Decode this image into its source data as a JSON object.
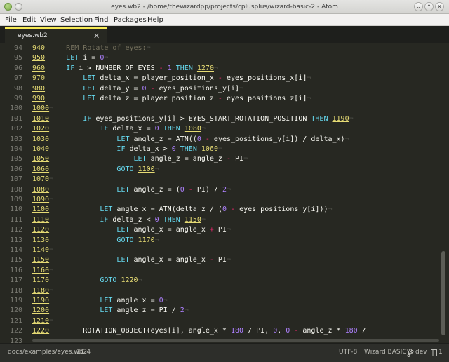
{
  "window": {
    "title": "eyes.wb2 - /home/thewizardpp/projects/cplusplus/wizard-basic-2 - Atom",
    "controls": {
      "minimize": "⌄",
      "maximize": "⌃",
      "close": "✕"
    }
  },
  "menu": [
    "File",
    "Edit",
    "View",
    "Selection",
    "Find",
    "Packages",
    "Help"
  ],
  "tab": {
    "label": "eyes.wb2",
    "close": "✕"
  },
  "colors": {
    "editor_bg": "#272822",
    "label": "#e6db74",
    "keyword": "#66d9ef",
    "operator": "#f92672",
    "number": "#ae81ff",
    "comment": "#75715e",
    "tab_accent": "#f7ea56"
  },
  "lines": [
    {
      "n": "94",
      "t": [
        [
          "lbl",
          "940"
        ],
        [
          "pl",
          "     "
        ],
        [
          "cmt",
          "REM Rotate of eyes:"
        ],
        [
          "ivs",
          "¬"
        ]
      ]
    },
    {
      "n": "95",
      "t": [
        [
          "lbl",
          "950"
        ],
        [
          "pl",
          "     "
        ],
        [
          "kw",
          "LET"
        ],
        [
          "pl",
          " i = "
        ],
        [
          "num",
          "0"
        ],
        [
          "ivs",
          "¬"
        ]
      ]
    },
    {
      "n": "96",
      "t": [
        [
          "lbl",
          "960"
        ],
        [
          "pl",
          "     "
        ],
        [
          "kw",
          "IF"
        ],
        [
          "pl",
          " i > NUMBER_OF_EYES "
        ],
        [
          "op",
          "-"
        ],
        [
          "pl",
          " "
        ],
        [
          "num",
          "1"
        ],
        [
          "pl",
          " "
        ],
        [
          "kw",
          "THEN"
        ],
        [
          "pl",
          " "
        ],
        [
          "lbl",
          "1270"
        ],
        [
          "ivs",
          "¬"
        ]
      ]
    },
    {
      "n": "97",
      "t": [
        [
          "lbl",
          "970"
        ],
        [
          "pl",
          "         "
        ],
        [
          "kw",
          "LET"
        ],
        [
          "pl",
          " delta_x = player_position_x "
        ],
        [
          "op",
          "-"
        ],
        [
          "pl",
          " eyes_positions_x[i]"
        ],
        [
          "ivs",
          "¬"
        ]
      ]
    },
    {
      "n": "98",
      "t": [
        [
          "lbl",
          "980"
        ],
        [
          "pl",
          "         "
        ],
        [
          "kw",
          "LET"
        ],
        [
          "pl",
          " delta_y = "
        ],
        [
          "num",
          "0"
        ],
        [
          "pl",
          " "
        ],
        [
          "op",
          "-"
        ],
        [
          "pl",
          " eyes_positions_y[i]"
        ],
        [
          "ivs",
          "¬"
        ]
      ]
    },
    {
      "n": "99",
      "t": [
        [
          "lbl",
          "990"
        ],
        [
          "pl",
          "         "
        ],
        [
          "kw",
          "LET"
        ],
        [
          "pl",
          " delta_z = player_position_z "
        ],
        [
          "op",
          "-"
        ],
        [
          "pl",
          " eyes_positions_z[i]"
        ],
        [
          "ivs",
          "¬"
        ]
      ]
    },
    {
      "n": "100",
      "t": [
        [
          "lbl",
          "1000"
        ],
        [
          "ivs",
          "¬"
        ]
      ]
    },
    {
      "n": "101",
      "t": [
        [
          "lbl",
          "1010"
        ],
        [
          "pl",
          "        "
        ],
        [
          "kw",
          "IF"
        ],
        [
          "pl",
          " eyes_positions_y[i] > EYES_START_ROTATION_POSITION "
        ],
        [
          "kw",
          "THEN"
        ],
        [
          "pl",
          " "
        ],
        [
          "lbl",
          "1190"
        ],
        [
          "ivs",
          "¬"
        ]
      ]
    },
    {
      "n": "102",
      "t": [
        [
          "lbl",
          "1020"
        ],
        [
          "pl",
          "            "
        ],
        [
          "kw",
          "IF"
        ],
        [
          "pl",
          " delta_x = "
        ],
        [
          "num",
          "0"
        ],
        [
          "pl",
          " "
        ],
        [
          "kw",
          "THEN"
        ],
        [
          "pl",
          " "
        ],
        [
          "lbl",
          "1080"
        ],
        [
          "ivs",
          "¬"
        ]
      ]
    },
    {
      "n": "103",
      "t": [
        [
          "lbl",
          "1030"
        ],
        [
          "pl",
          "                "
        ],
        [
          "kw",
          "LET"
        ],
        [
          "pl",
          " angle_z = ATN(("
        ],
        [
          "num",
          "0"
        ],
        [
          "pl",
          " "
        ],
        [
          "op",
          "-"
        ],
        [
          "pl",
          " eyes_positions_y[i]) / delta_x)"
        ],
        [
          "ivs",
          "¬"
        ]
      ]
    },
    {
      "n": "104",
      "t": [
        [
          "lbl",
          "1040"
        ],
        [
          "pl",
          "                "
        ],
        [
          "kw",
          "IF"
        ],
        [
          "pl",
          " delta_x > "
        ],
        [
          "num",
          "0"
        ],
        [
          "pl",
          " "
        ],
        [
          "kw",
          "THEN"
        ],
        [
          "pl",
          " "
        ],
        [
          "lbl",
          "1060"
        ],
        [
          "ivs",
          "¬"
        ]
      ]
    },
    {
      "n": "105",
      "t": [
        [
          "lbl",
          "1050"
        ],
        [
          "pl",
          "                    "
        ],
        [
          "kw",
          "LET"
        ],
        [
          "pl",
          " angle_z = angle_z "
        ],
        [
          "op",
          "-"
        ],
        [
          "pl",
          " PI"
        ],
        [
          "ivs",
          "¬"
        ]
      ]
    },
    {
      "n": "106",
      "t": [
        [
          "lbl",
          "1060"
        ],
        [
          "pl",
          "                "
        ],
        [
          "kw",
          "GOTO"
        ],
        [
          "pl",
          " "
        ],
        [
          "lbl",
          "1100"
        ],
        [
          "ivs",
          "¬"
        ]
      ]
    },
    {
      "n": "107",
      "t": [
        [
          "lbl",
          "1070"
        ],
        [
          "ivs",
          "¬"
        ]
      ]
    },
    {
      "n": "108",
      "t": [
        [
          "lbl",
          "1080"
        ],
        [
          "pl",
          "                "
        ],
        [
          "kw",
          "LET"
        ],
        [
          "pl",
          " angle_z = ("
        ],
        [
          "num",
          "0"
        ],
        [
          "pl",
          " "
        ],
        [
          "op",
          "-"
        ],
        [
          "pl",
          " PI) / "
        ],
        [
          "num",
          "2"
        ],
        [
          "ivs",
          "¬"
        ]
      ]
    },
    {
      "n": "109",
      "t": [
        [
          "lbl",
          "1090"
        ],
        [
          "ivs",
          "¬"
        ]
      ]
    },
    {
      "n": "110",
      "t": [
        [
          "lbl",
          "1100"
        ],
        [
          "pl",
          "            "
        ],
        [
          "kw",
          "LET"
        ],
        [
          "pl",
          " angle_x = ATN(delta_z / ("
        ],
        [
          "num",
          "0"
        ],
        [
          "pl",
          " "
        ],
        [
          "op",
          "-"
        ],
        [
          "pl",
          " eyes_positions_y[i]))"
        ],
        [
          "ivs",
          "¬"
        ]
      ]
    },
    {
      "n": "111",
      "t": [
        [
          "lbl",
          "1110"
        ],
        [
          "pl",
          "            "
        ],
        [
          "kw",
          "IF"
        ],
        [
          "pl",
          " delta_z < "
        ],
        [
          "num",
          "0"
        ],
        [
          "pl",
          " "
        ],
        [
          "kw",
          "THEN"
        ],
        [
          "pl",
          " "
        ],
        [
          "lbl",
          "1150"
        ],
        [
          "ivs",
          "¬"
        ]
      ]
    },
    {
      "n": "112",
      "t": [
        [
          "lbl",
          "1120"
        ],
        [
          "pl",
          "                "
        ],
        [
          "kw",
          "LET"
        ],
        [
          "pl",
          " angle_x = angle_x "
        ],
        [
          "op",
          "+"
        ],
        [
          "pl",
          " PI"
        ],
        [
          "ivs",
          "¬"
        ]
      ]
    },
    {
      "n": "113",
      "t": [
        [
          "lbl",
          "1130"
        ],
        [
          "pl",
          "                "
        ],
        [
          "kw",
          "GOTO"
        ],
        [
          "pl",
          " "
        ],
        [
          "lbl",
          "1170"
        ],
        [
          "ivs",
          "¬"
        ]
      ]
    },
    {
      "n": "114",
      "t": [
        [
          "lbl",
          "1140"
        ],
        [
          "ivs",
          "¬"
        ]
      ]
    },
    {
      "n": "115",
      "t": [
        [
          "lbl",
          "1150"
        ],
        [
          "pl",
          "                "
        ],
        [
          "kw",
          "LET"
        ],
        [
          "pl",
          " angle_x = angle_x "
        ],
        [
          "op",
          "-"
        ],
        [
          "pl",
          " PI"
        ],
        [
          "ivs",
          "¬"
        ]
      ]
    },
    {
      "n": "116",
      "t": [
        [
          "lbl",
          "1160"
        ],
        [
          "ivs",
          "¬"
        ]
      ]
    },
    {
      "n": "117",
      "t": [
        [
          "lbl",
          "1170"
        ],
        [
          "pl",
          "            "
        ],
        [
          "kw",
          "GOTO"
        ],
        [
          "pl",
          " "
        ],
        [
          "lbl",
          "1220"
        ],
        [
          "ivs",
          "¬"
        ]
      ]
    },
    {
      "n": "118",
      "t": [
        [
          "lbl",
          "1180"
        ],
        [
          "ivs",
          "¬"
        ]
      ]
    },
    {
      "n": "119",
      "t": [
        [
          "lbl",
          "1190"
        ],
        [
          "pl",
          "            "
        ],
        [
          "kw",
          "LET"
        ],
        [
          "pl",
          " angle_x = "
        ],
        [
          "num",
          "0"
        ],
        [
          "ivs",
          "¬"
        ]
      ]
    },
    {
      "n": "120",
      "t": [
        [
          "lbl",
          "1200"
        ],
        [
          "pl",
          "            "
        ],
        [
          "kw",
          "LET"
        ],
        [
          "pl",
          " angle_z = PI / "
        ],
        [
          "num",
          "2"
        ],
        [
          "ivs",
          "¬"
        ]
      ]
    },
    {
      "n": "121",
      "t": [
        [
          "lbl",
          "1210"
        ],
        [
          "ivs",
          "¬"
        ]
      ]
    },
    {
      "n": "122",
      "t": [
        [
          "lbl",
          "1220"
        ],
        [
          "pl",
          "        ROTATION_OBJECT(eyes[i], angle_x * "
        ],
        [
          "num",
          "180"
        ],
        [
          "pl",
          " / PI, "
        ],
        [
          "num",
          "0"
        ],
        [
          "pl",
          ", "
        ],
        [
          "num",
          "0"
        ],
        [
          "pl",
          " "
        ],
        [
          "op",
          "-"
        ],
        [
          "pl",
          " angle_z * "
        ],
        [
          "num",
          "180"
        ],
        [
          "pl",
          " /"
        ]
      ]
    },
    {
      "n": "123",
      "t": []
    }
  ],
  "status": {
    "path": "docs/examples/eyes.wb2",
    "cursor": "11,4",
    "encoding": "UTF-8",
    "grammar": "Wizard BASIC 2",
    "branch": "dev",
    "count": "1"
  }
}
